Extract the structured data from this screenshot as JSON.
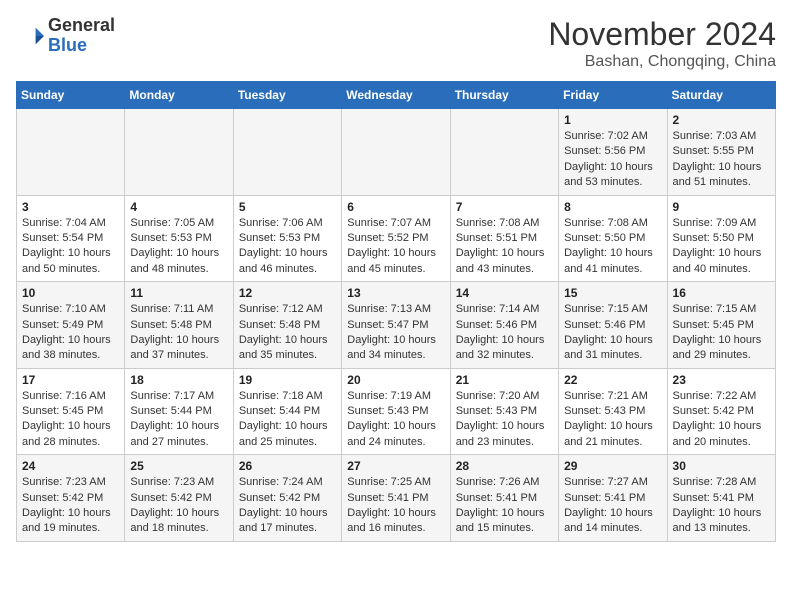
{
  "header": {
    "logo_general": "General",
    "logo_blue": "Blue",
    "month": "November 2024",
    "location": "Bashan, Chongqing, China"
  },
  "days_of_week": [
    "Sunday",
    "Monday",
    "Tuesday",
    "Wednesday",
    "Thursday",
    "Friday",
    "Saturday"
  ],
  "weeks": [
    [
      {
        "day": "",
        "info": ""
      },
      {
        "day": "",
        "info": ""
      },
      {
        "day": "",
        "info": ""
      },
      {
        "day": "",
        "info": ""
      },
      {
        "day": "",
        "info": ""
      },
      {
        "day": "1",
        "info": "Sunrise: 7:02 AM\nSunset: 5:56 PM\nDaylight: 10 hours and 53 minutes."
      },
      {
        "day": "2",
        "info": "Sunrise: 7:03 AM\nSunset: 5:55 PM\nDaylight: 10 hours and 51 minutes."
      }
    ],
    [
      {
        "day": "3",
        "info": "Sunrise: 7:04 AM\nSunset: 5:54 PM\nDaylight: 10 hours and 50 minutes."
      },
      {
        "day": "4",
        "info": "Sunrise: 7:05 AM\nSunset: 5:53 PM\nDaylight: 10 hours and 48 minutes."
      },
      {
        "day": "5",
        "info": "Sunrise: 7:06 AM\nSunset: 5:53 PM\nDaylight: 10 hours and 46 minutes."
      },
      {
        "day": "6",
        "info": "Sunrise: 7:07 AM\nSunset: 5:52 PM\nDaylight: 10 hours and 45 minutes."
      },
      {
        "day": "7",
        "info": "Sunrise: 7:08 AM\nSunset: 5:51 PM\nDaylight: 10 hours and 43 minutes."
      },
      {
        "day": "8",
        "info": "Sunrise: 7:08 AM\nSunset: 5:50 PM\nDaylight: 10 hours and 41 minutes."
      },
      {
        "day": "9",
        "info": "Sunrise: 7:09 AM\nSunset: 5:50 PM\nDaylight: 10 hours and 40 minutes."
      }
    ],
    [
      {
        "day": "10",
        "info": "Sunrise: 7:10 AM\nSunset: 5:49 PM\nDaylight: 10 hours and 38 minutes."
      },
      {
        "day": "11",
        "info": "Sunrise: 7:11 AM\nSunset: 5:48 PM\nDaylight: 10 hours and 37 minutes."
      },
      {
        "day": "12",
        "info": "Sunrise: 7:12 AM\nSunset: 5:48 PM\nDaylight: 10 hours and 35 minutes."
      },
      {
        "day": "13",
        "info": "Sunrise: 7:13 AM\nSunset: 5:47 PM\nDaylight: 10 hours and 34 minutes."
      },
      {
        "day": "14",
        "info": "Sunrise: 7:14 AM\nSunset: 5:46 PM\nDaylight: 10 hours and 32 minutes."
      },
      {
        "day": "15",
        "info": "Sunrise: 7:15 AM\nSunset: 5:46 PM\nDaylight: 10 hours and 31 minutes."
      },
      {
        "day": "16",
        "info": "Sunrise: 7:15 AM\nSunset: 5:45 PM\nDaylight: 10 hours and 29 minutes."
      }
    ],
    [
      {
        "day": "17",
        "info": "Sunrise: 7:16 AM\nSunset: 5:45 PM\nDaylight: 10 hours and 28 minutes."
      },
      {
        "day": "18",
        "info": "Sunrise: 7:17 AM\nSunset: 5:44 PM\nDaylight: 10 hours and 27 minutes."
      },
      {
        "day": "19",
        "info": "Sunrise: 7:18 AM\nSunset: 5:44 PM\nDaylight: 10 hours and 25 minutes."
      },
      {
        "day": "20",
        "info": "Sunrise: 7:19 AM\nSunset: 5:43 PM\nDaylight: 10 hours and 24 minutes."
      },
      {
        "day": "21",
        "info": "Sunrise: 7:20 AM\nSunset: 5:43 PM\nDaylight: 10 hours and 23 minutes."
      },
      {
        "day": "22",
        "info": "Sunrise: 7:21 AM\nSunset: 5:43 PM\nDaylight: 10 hours and 21 minutes."
      },
      {
        "day": "23",
        "info": "Sunrise: 7:22 AM\nSunset: 5:42 PM\nDaylight: 10 hours and 20 minutes."
      }
    ],
    [
      {
        "day": "24",
        "info": "Sunrise: 7:23 AM\nSunset: 5:42 PM\nDaylight: 10 hours and 19 minutes."
      },
      {
        "day": "25",
        "info": "Sunrise: 7:23 AM\nSunset: 5:42 PM\nDaylight: 10 hours and 18 minutes."
      },
      {
        "day": "26",
        "info": "Sunrise: 7:24 AM\nSunset: 5:42 PM\nDaylight: 10 hours and 17 minutes."
      },
      {
        "day": "27",
        "info": "Sunrise: 7:25 AM\nSunset: 5:41 PM\nDaylight: 10 hours and 16 minutes."
      },
      {
        "day": "28",
        "info": "Sunrise: 7:26 AM\nSunset: 5:41 PM\nDaylight: 10 hours and 15 minutes."
      },
      {
        "day": "29",
        "info": "Sunrise: 7:27 AM\nSunset: 5:41 PM\nDaylight: 10 hours and 14 minutes."
      },
      {
        "day": "30",
        "info": "Sunrise: 7:28 AM\nSunset: 5:41 PM\nDaylight: 10 hours and 13 minutes."
      }
    ]
  ]
}
